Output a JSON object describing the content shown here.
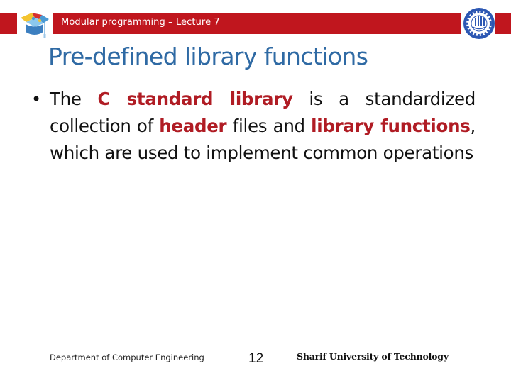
{
  "header": {
    "course_title": "Modular programming – Lecture 7",
    "bar_color": "#c0161e",
    "left_logo_icon": "graduation-cap-puzzle-icon",
    "right_logo_icon": "sharif-university-seal-icon"
  },
  "slide": {
    "title": "Pre-defined library functions",
    "title_color": "#2f6aa4",
    "bullet_symbol": "•",
    "emphasis_color": "#b01c24",
    "bullet_segments": [
      {
        "text": "The ",
        "emphasis": false
      },
      {
        "text": "C standard library",
        "emphasis": true
      },
      {
        "text": " is a standardized collection of ",
        "emphasis": false
      },
      {
        "text": "header",
        "emphasis": true
      },
      {
        "text": " files and ",
        "emphasis": false
      },
      {
        "text": "library functions",
        "emphasis": true
      },
      {
        "text": ", which are used to implement common operations",
        "emphasis": false
      }
    ]
  },
  "footer": {
    "department": "Department of Computer Engineering",
    "page_number": "12",
    "university": "Sharif University of Technology"
  }
}
